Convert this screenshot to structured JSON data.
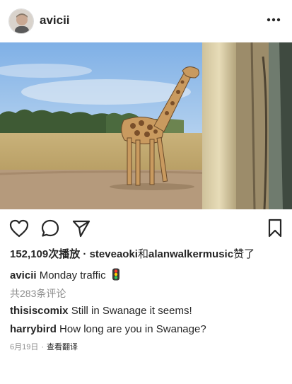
{
  "post": {
    "username": "avicii",
    "avatar_icon": "profile-avatar",
    "more_icon": "more-options-icon"
  },
  "actions": {
    "like_icon": "heart-icon",
    "comment_icon": "comment-icon",
    "share_icon": "send-icon",
    "save_icon": "bookmark-icon"
  },
  "stats": {
    "views": "152,109次播放",
    "separator": " · ",
    "liked_by_a": "steveaoki",
    "and_text": "和",
    "liked_by_b": "alanwalkermusic",
    "liked_suffix": "赞了"
  },
  "caption": {
    "author": "avicii",
    "text": "Monday traffic",
    "emoji_icon": "traffic-light-icon"
  },
  "comments_link": "共283条评论",
  "comments": [
    {
      "author": "thisiscomix",
      "text": "Still in Swanage it seems!"
    },
    {
      "author": "harrybird",
      "text": "How long are you in Swanage?"
    }
  ],
  "meta": {
    "date": "6月19日",
    "dot": "·",
    "translate": "查看翻译"
  }
}
